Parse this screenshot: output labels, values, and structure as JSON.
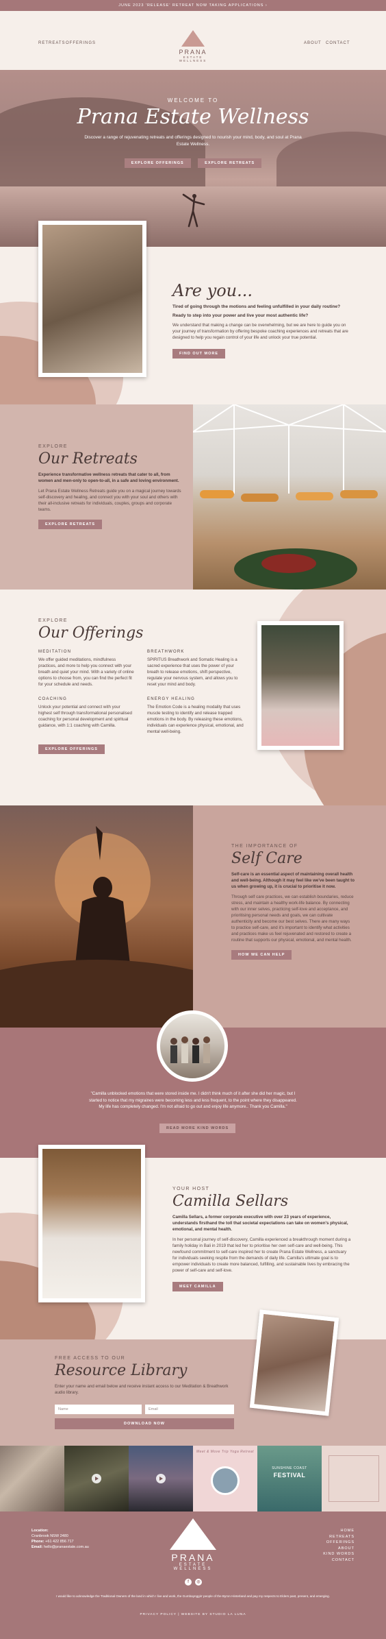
{
  "topbar": {
    "text": "JUNE 2023 'RELEASE' RETREAT NOW TAKING APPLICATIONS ›"
  },
  "nav": {
    "left": [
      "RETREATS",
      "OFFERINGS"
    ],
    "right": [
      "ABOUT",
      "CONTACT"
    ]
  },
  "logo": {
    "name": "PRANA",
    "sub1": "ESTATE",
    "sub2": "WELLNESS"
  },
  "hero": {
    "welcome": "WELCOME TO",
    "title": "Prana Estate Wellness",
    "lead": "Discover a range of rejuvenating retreats and offerings designed to nourish your mind, body, and soul at Prana Estate Wellness.",
    "btn1": "EXPLORE OFFERINGS",
    "btn2": "EXPLORE RETREATS"
  },
  "areyou": {
    "title": "Are you...",
    "q1": "Tired of going through the motions and feeling unfulfilled in your daily routine?",
    "q2": "Ready to step into your power and live your most authentic life?",
    "body": "We understand that making a change can be overwhelming, but we are here to guide you on your journey of transformation by offering bespoke coaching experiences and retreats that are designed to help you regain control of your life and unlock your true potential.",
    "button": "FIND OUT MORE"
  },
  "retreats": {
    "kicker": "EXPLORE",
    "title": "Our Retreats",
    "lead": "Experience transformative wellness retreats that cater to all, from women and men-only to open-to-all, in a safe and loving environment.",
    "body": "Let Prana Estate Wellness Retreats guide you on a magical journey towards self-discovery and healing, and connect you with your soul and others with their all-inclusive retreats for individuals, couples, groups and corporate teams.",
    "button": "EXPLORE RETREATS"
  },
  "offerings": {
    "kicker": "EXPLORE",
    "title": "Our Offerings",
    "items": [
      {
        "heading": "MEDITATION",
        "text": "We offer guided meditations, mindfulness practices, and more to help you connect with your breath and quiet your mind. With a variety of online options to choose from, you can find the perfect fit for your schedule and needs."
      },
      {
        "heading": "BREATHWORK",
        "text": "SPIRITUS Breathwork and Somatic Healing is a sacred experience that uses the power of your breath to release emotions, shift perspective, regulate your nervous system, and allows you to reset your mind and body."
      },
      {
        "heading": "COACHING",
        "text": "Unlock your potential and connect with your highest self through transformational personalised coaching for personal development and spiritual guidance, with 1:1 coaching with Camilla."
      },
      {
        "heading": "ENERGY HEALING",
        "text": "The Emotion Code is a healing modality that uses muscle testing to identify and release trapped emotions in the body. By releasing these emotions, individuals can experience physical, emotional, and mental well-being."
      }
    ],
    "button": "EXPLORE OFFERINGS"
  },
  "selfcare": {
    "kicker": "THE IMPORTANCE OF",
    "title": "Self Care",
    "lead": "Self-care is an essential aspect of maintaining overall health and well-being. Although it may feel like we've been taught to us when growing up, it is crucial to prioritise it now.",
    "body": "Through self care practices, we can establish boundaries, reduce stress, and maintain a healthy work-life balance. By connecting with our inner selves, practicing self-love and acceptance, and prioritising personal needs and goals, we can cultivate authenticity and become our best selves. There are many ways to practice self-care, and it's important to identify what activities and practices make us feel rejuvenated and restored to create a routine that supports our physical, emotional, and mental health.",
    "button": "HOW WE CAN HELP"
  },
  "testimonial": {
    "quote": "\"Camilla unblocked emotions that were stored inside me. I didn't think much of it after she did her magic, but I started to notice that my migraines were becoming less and less frequent, to the point where they disappeared. My life has completely changed. I'm not afraid to go out and enjoy life anymore.. Thank you Camilla.\"",
    "button": "READ MORE KIND WORDS"
  },
  "host": {
    "kicker": "YOUR HOST",
    "title": "Camilla Sellars",
    "lead": "Camilla Sellars, a former corporate executive with over 23 years of experience, understands firsthand the toll that societal expectations can take on women's physical, emotional, and mental health.",
    "body": "In her personal journey of self-discovery, Camilla experienced a breakthrough moment during a family holiday in Bali in 2019 that led her to prioritise her own self-care and well-being. This newfound commitment to self-care inspired her to create Prana Estate Wellness, a sanctuary for individuals seeking respite from the demands of daily life. Camilla's ultimate goal is to empower individuals to create more balanced, fulfilling, and sustainable lives by embracing the power of self-care and self-love.",
    "button": "MEET CAMILLA"
  },
  "resource": {
    "kicker": "FREE ACCESS TO OUR",
    "title": "Resource Library",
    "body": "Enter your name and email below and receive instant access to our Meditation & Breathwork audio library.",
    "name_placeholder": "Name",
    "email_placeholder": "Email",
    "button": "DOWNLOAD NOW"
  },
  "gallery": {
    "tile4": "Meet & Move Trip Yoga Retreat",
    "tile5a": "SUNSHINE COAST",
    "tile5b": "FESTIVAL"
  },
  "footer": {
    "location_label": "Location:",
    "location": "Cranbrook NSW 2480",
    "phone_label": "Phone:",
    "phone": "+61 422 856 717",
    "email_label": "Email:",
    "email": "hello@pranaestate.com.au",
    "nav": [
      "HOME",
      "RETREATS",
      "OFFERINGS",
      "ABOUT",
      "KIND WORDS",
      "CONTACT"
    ],
    "ack": "I would like to acknowledge the Traditional Owners of the land in which I live and work, the Gumbaynggirr people of the Byron Hinterland and pay my respects to Elders past, present, and emerging.",
    "legal": "PRIVACY POLICY | WEBSITE BY STUDIO LA LUNA"
  },
  "colors": {
    "accent": "#a57779",
    "sand": "#d2b5ad",
    "cream": "#f6efea",
    "text": "#4a3a38"
  }
}
